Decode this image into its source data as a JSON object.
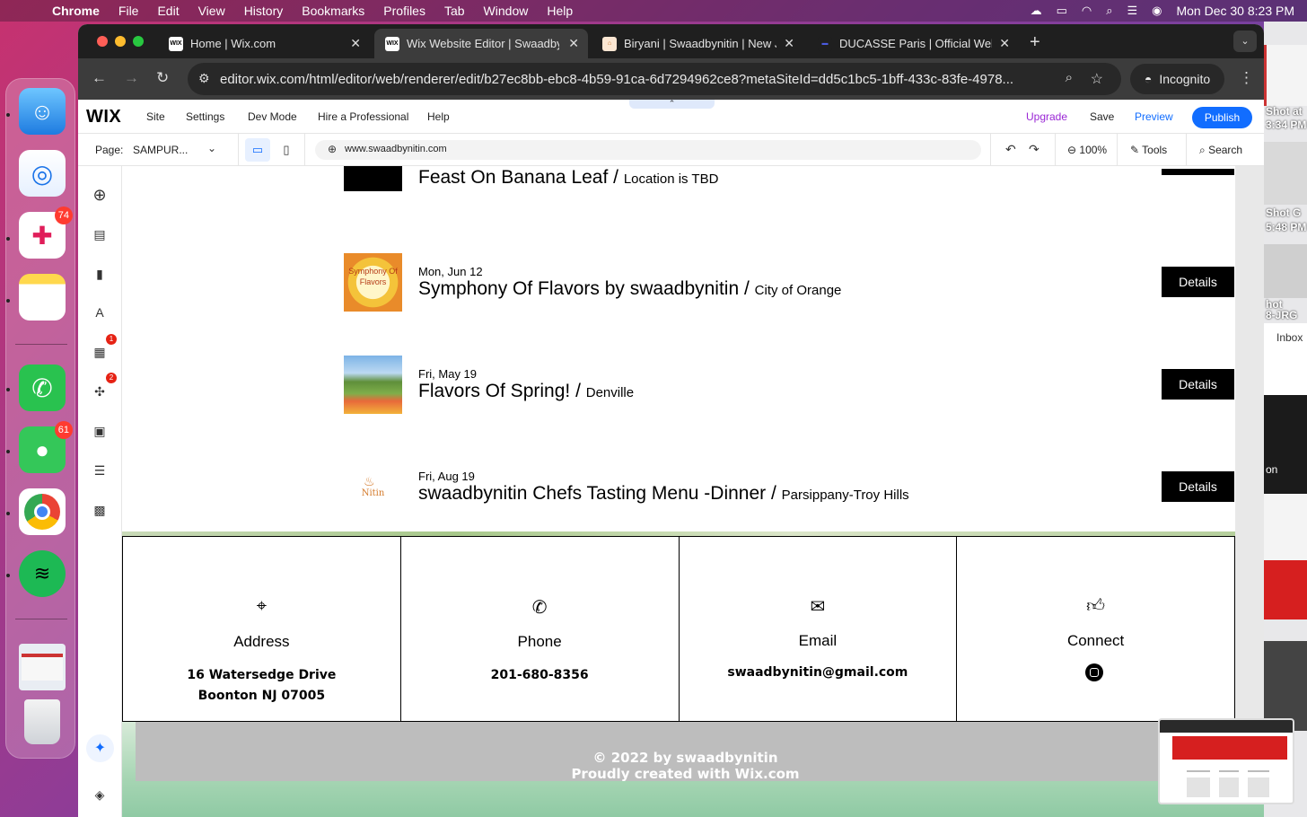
{
  "menubar": {
    "app": "Chrome",
    "items": [
      "File",
      "Edit",
      "View",
      "History",
      "Bookmarks",
      "Profiles",
      "Tab",
      "Window",
      "Help"
    ],
    "clock": "Mon Dec 30  8:23 PM"
  },
  "dock": {
    "badges": {
      "slack": "74",
      "messages": "61"
    }
  },
  "right_strip": {
    "labels": [
      "Shot at",
      "3:34 PM",
      "Shot",
      "G",
      "5:48 PM",
      "hot",
      "8-JRG",
      "Inbox",
      "on"
    ]
  },
  "tabs": [
    {
      "title": "Home | Wix.com",
      "favicon": "WIX"
    },
    {
      "title": "Wix Website Editor | Swaadbynitin",
      "favicon": "WIX"
    },
    {
      "title": "Biryani | Swaadbynitin | New Jersey",
      "favicon": ""
    },
    {
      "title": "DUCASSE Paris | Official Website",
      "favicon": ""
    }
  ],
  "toolbar": {
    "url": "editor.wix.com/html/editor/web/renderer/edit/b27ec8bb-ebc8-4b59-91ca-6d7294962ce8?metaSiteId=dd5c1bc5-1bff-433c-83fe-4978...",
    "incognito": "Incognito"
  },
  "wix": {
    "logo": "WIX",
    "menu": [
      "Site",
      "Settings",
      "Dev Mode",
      "Hire a Professional",
      "Help"
    ],
    "upgrade": "Upgrade",
    "save": "Save",
    "preview": "Preview",
    "publish": "Publish",
    "page_label": "Page:",
    "page_name": "SAMPUR...",
    "domain": "www.swaadbynitin.com",
    "zoom": "100%",
    "tools": "Tools",
    "search": "Search",
    "rail_badges": [
      "1",
      "2"
    ]
  },
  "events": {
    "partial": {
      "title": "Feast On Banana Leaf",
      "loc": "Location is TBD"
    },
    "items": [
      {
        "date": "Mon, Jun 12",
        "title": "Symphony Of Flavors by swaadbynitin",
        "sep": " / ",
        "location": "City of Orange",
        "button": "Details",
        "thumb_text": "Symphony Of Flavors"
      },
      {
        "date": "Fri, May 19",
        "title": "Flavors Of Spring!",
        "sep": " / ",
        "location": "Denville",
        "button": "Details"
      },
      {
        "date": "Fri, Aug 19",
        "title": "swaadbynitin Chefs Tasting Menu -Dinner",
        "sep": " / ",
        "location": "Parsippany-Troy Hills",
        "button": "Details",
        "thumb_text": "Nitin"
      }
    ]
  },
  "contact": {
    "address": {
      "label": "Address",
      "line1": "16 Watersedge Drive",
      "line2": "Boonton NJ 07005"
    },
    "phone": {
      "label": "Phone",
      "value": "201-680-8356"
    },
    "email": {
      "label": "Email",
      "value": "swaadbynitin@gmail.com"
    },
    "connect": {
      "label": "Connect"
    }
  },
  "footer": {
    "line1": "© 2022 by swaadbynitin",
    "line2": "Proudly created with Wix.com"
  }
}
